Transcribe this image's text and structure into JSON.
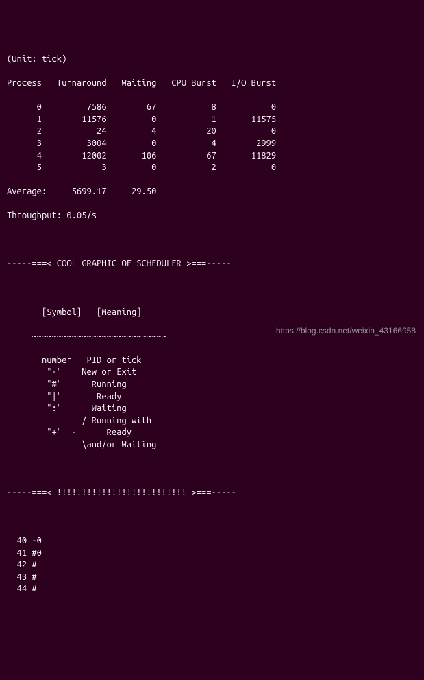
{
  "header": {
    "unit_line": "(Unit: tick)",
    "col_process": "Process",
    "col_turnaround": "Turnaround",
    "col_waiting": "Waiting",
    "col_cpu": "CPU Burst",
    "col_io": "I/O Burst"
  },
  "rows": [
    {
      "process": "0",
      "turnaround": "7586",
      "waiting": "67",
      "cpu": "8",
      "io": "0"
    },
    {
      "process": "1",
      "turnaround": "11576",
      "waiting": "0",
      "cpu": "1",
      "io": "11575"
    },
    {
      "process": "2",
      "turnaround": "24",
      "waiting": "4",
      "cpu": "20",
      "io": "0"
    },
    {
      "process": "3",
      "turnaround": "3004",
      "waiting": "0",
      "cpu": "4",
      "io": "2999"
    },
    {
      "process": "4",
      "turnaround": "12002",
      "waiting": "106",
      "cpu": "67",
      "io": "11829"
    },
    {
      "process": "5",
      "turnaround": "3",
      "waiting": "0",
      "cpu": "2",
      "io": "0"
    }
  ],
  "summary": {
    "avg_label": "Average:",
    "avg_turnaround": "5699.17",
    "avg_waiting": "29.50",
    "throughput_line": "Throughput: 0.05/s"
  },
  "graphic": {
    "divider_top": "-----===< COOL GRAPHIC OF SCHEDULER >===-----",
    "legend_header": "       [Symbol]   [Meaning]",
    "legend_tilde": "     ~~~~~~~~~~~~~~~~~~~~~~~~~~~",
    "legend_lines": [
      "       number   PID or tick",
      "        \"-\"    New or Exit",
      "        \"#\"      Running",
      "        \"|\"       Ready",
      "        \":\"      Waiting",
      "               / Running with",
      "        \"+\"  -|     Ready",
      "               \\and/or Waiting"
    ],
    "divider_bottom": "-----===< !!!!!!!!!!!!!!!!!!!!!!!!!! >===-----"
  },
  "trace": [
    "  40 -0",
    "  41 #0",
    "  42 #",
    "  43 #",
    "  44 #"
  ],
  "watermark": "https://blog.csdn.net/weixin_43166958"
}
